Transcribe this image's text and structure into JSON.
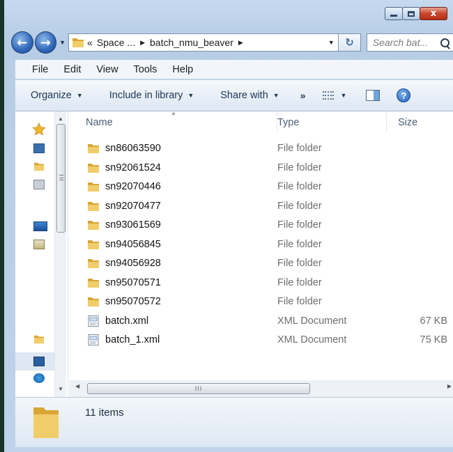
{
  "window": {
    "caption_buttons": {
      "minimize": "minimize-icon",
      "maximize": "maximize-icon",
      "close": "close-icon"
    },
    "close_glyph": "x"
  },
  "navigation": {
    "back_icon": "back-arrow-icon",
    "forward_icon": "forward-arrow-icon",
    "breadcrumb_prefix": "«",
    "breadcrumbs": [
      "Space ...",
      "batch_nmu_beaver"
    ],
    "search_placeholder": "Search bat..."
  },
  "menubar": {
    "items": [
      "File",
      "Edit",
      "View",
      "Tools",
      "Help"
    ]
  },
  "commandbar": {
    "organize": "Organize",
    "include_in_library": "Include in library",
    "share_with": "Share with",
    "more": "»"
  },
  "columns": {
    "name": "Name",
    "type": "Type",
    "size": "Size"
  },
  "files": [
    {
      "name": "sn86063590",
      "type": "File folder",
      "size": "",
      "icon": "folder-icon"
    },
    {
      "name": "sn92061524",
      "type": "File folder",
      "size": "",
      "icon": "folder-icon"
    },
    {
      "name": "sn92070446",
      "type": "File folder",
      "size": "",
      "icon": "folder-icon"
    },
    {
      "name": "sn92070477",
      "type": "File folder",
      "size": "",
      "icon": "folder-icon"
    },
    {
      "name": "sn93061569",
      "type": "File folder",
      "size": "",
      "icon": "folder-icon"
    },
    {
      "name": "sn94056845",
      "type": "File folder",
      "size": "",
      "icon": "folder-icon"
    },
    {
      "name": "sn94056928",
      "type": "File folder",
      "size": "",
      "icon": "folder-icon"
    },
    {
      "name": "sn95070571",
      "type": "File folder",
      "size": "",
      "icon": "folder-icon"
    },
    {
      "name": "sn95070572",
      "type": "File folder",
      "size": "",
      "icon": "folder-icon"
    },
    {
      "name": "batch.xml",
      "type": "XML Document",
      "size": "67 KB",
      "icon": "xml-file-icon"
    },
    {
      "name": "batch_1.xml",
      "type": "XML Document",
      "size": "75 KB",
      "icon": "xml-file-icon"
    }
  ],
  "status": {
    "item_count": "11 items"
  }
}
